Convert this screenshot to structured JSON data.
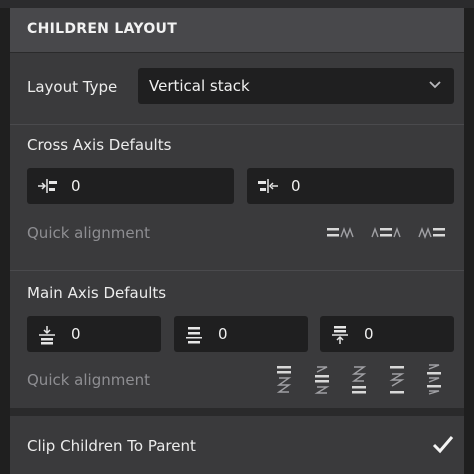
{
  "header": {
    "title": "CHILDREN LAYOUT"
  },
  "layout": {
    "label": "Layout Type",
    "value": "Vertical stack"
  },
  "cross_axis": {
    "title": "Cross Axis Defaults",
    "fields": [
      {
        "icon": "align-left-padding-icon",
        "value": "0"
      },
      {
        "icon": "align-right-padding-icon",
        "value": "0"
      }
    ],
    "quick_label": "Quick alignment",
    "quick_icons": [
      "cross-align-start-icon",
      "cross-align-center-icon",
      "cross-align-end-icon"
    ]
  },
  "main_axis": {
    "title": "Main Axis Defaults",
    "fields": [
      {
        "icon": "padding-top-icon",
        "value": "0"
      },
      {
        "icon": "spacing-icon",
        "value": "0"
      },
      {
        "icon": "padding-bottom-icon",
        "value": "0"
      }
    ],
    "quick_label": "Quick alignment",
    "quick_icons": [
      "main-align-start-icon",
      "main-align-center-icon",
      "main-align-end-icon",
      "main-align-space-between-icon",
      "main-align-space-around-icon"
    ]
  },
  "clip": {
    "label": "Clip Children To Parent",
    "checked": true
  }
}
